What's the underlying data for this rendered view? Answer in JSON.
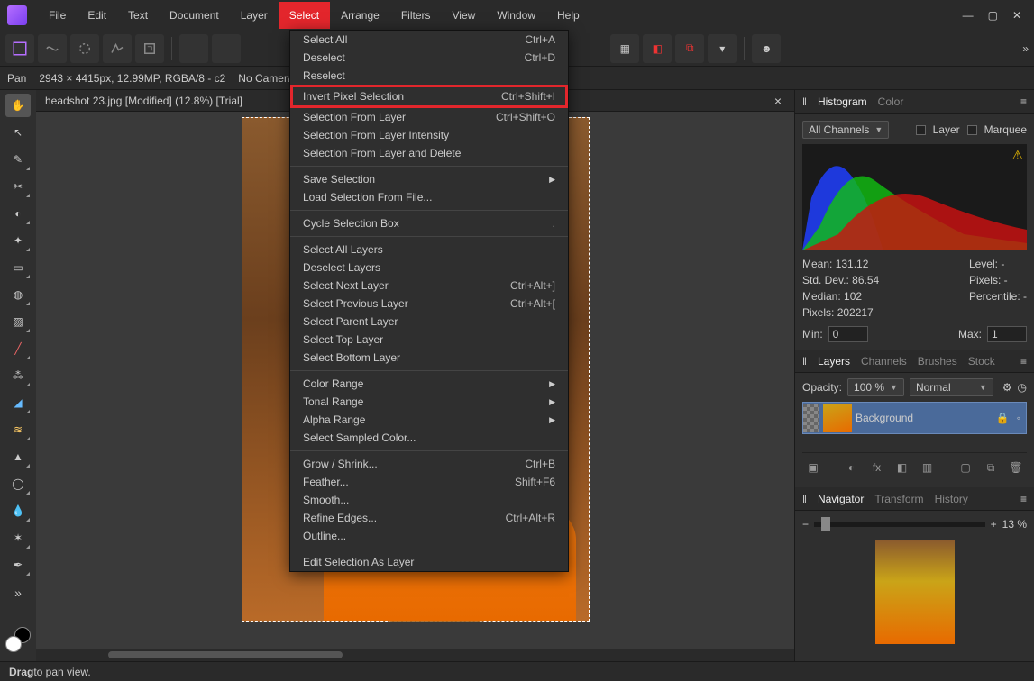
{
  "menubar": {
    "items": [
      "File",
      "Edit",
      "Text",
      "Document",
      "Layer",
      "Select",
      "Arrange",
      "Filters",
      "View",
      "Window",
      "Help"
    ],
    "highlighted_index": 5
  },
  "context_bar": {
    "tool_label": "Pan",
    "doc_info": "2943 × 4415px, 12.99MP, RGBA/8 - c2",
    "camera": "No Camera Data"
  },
  "document_tab": {
    "title": "headshot 23.jpg [Modified] (12.8%) [Trial]"
  },
  "select_menu": [
    {
      "label": "Select All",
      "shortcut": "Ctrl+A"
    },
    {
      "label": "Deselect",
      "shortcut": "Ctrl+D"
    },
    {
      "label": "Reselect",
      "disabled": true
    },
    {
      "label": "Invert Pixel Selection",
      "shortcut": "Ctrl+Shift+I",
      "highlight": true
    },
    {
      "label": "Selection From Layer",
      "shortcut": "Ctrl+Shift+O"
    },
    {
      "label": "Selection From Layer Intensity"
    },
    {
      "label": "Selection From Layer and Delete"
    },
    {
      "sep": true
    },
    {
      "label": "Save Selection",
      "submenu": true
    },
    {
      "label": "Load Selection From File..."
    },
    {
      "sep": true
    },
    {
      "label": "Cycle Selection Box",
      "shortcut": "."
    },
    {
      "sep": true
    },
    {
      "label": "Select All Layers"
    },
    {
      "label": "Deselect Layers"
    },
    {
      "label": "Select Next Layer",
      "shortcut": "Ctrl+Alt+]"
    },
    {
      "label": "Select Previous Layer",
      "shortcut": "Ctrl+Alt+["
    },
    {
      "label": "Select Parent Layer",
      "disabled": true
    },
    {
      "label": "Select Top Layer"
    },
    {
      "label": "Select Bottom Layer"
    },
    {
      "sep": true
    },
    {
      "label": "Color Range",
      "submenu": true
    },
    {
      "label": "Tonal Range",
      "submenu": true
    },
    {
      "label": "Alpha Range",
      "submenu": true
    },
    {
      "label": "Select Sampled Color..."
    },
    {
      "sep": true
    },
    {
      "label": "Grow / Shrink...",
      "shortcut": "Ctrl+B"
    },
    {
      "label": "Feather...",
      "shortcut": "Shift+F6"
    },
    {
      "label": "Smooth..."
    },
    {
      "label": "Refine Edges...",
      "shortcut": "Ctrl+Alt+R"
    },
    {
      "label": "Outline..."
    },
    {
      "sep": true
    },
    {
      "label": "Edit Selection As Layer"
    }
  ],
  "histogram_panel": {
    "tabs": [
      "Histogram",
      "Color"
    ],
    "active_tab": 0,
    "channel": "All Channels",
    "layer_label": "Layer",
    "marquee_label": "Marquee",
    "stats": {
      "mean_label": "Mean:",
      "mean": "131.12",
      "stddev_label": "Std. Dev.:",
      "stddev": "86.54",
      "median_label": "Median:",
      "median": "102",
      "pixels_label": "Pixels:",
      "pixels": "202217",
      "level_label": "Level:",
      "level": "-",
      "pixels2_label": "Pixels:",
      "pixels2": "-",
      "percentile_label": "Percentile:",
      "percentile": "-"
    },
    "min_label": "Min:",
    "min": "0",
    "max_label": "Max:",
    "max": "1"
  },
  "layers_panel": {
    "tabs": [
      "Layers",
      "Channels",
      "Brushes",
      "Stock"
    ],
    "active_tab": 0,
    "opacity_label": "Opacity:",
    "opacity": "100 %",
    "blend_mode": "Normal",
    "layer_name": "Background"
  },
  "navigator_panel": {
    "tabs": [
      "Navigator",
      "Transform",
      "History"
    ],
    "active_tab": 0,
    "zoom": "13 %"
  },
  "statusbar": {
    "hint_prefix": "Drag",
    "hint_rest": " to pan view."
  }
}
